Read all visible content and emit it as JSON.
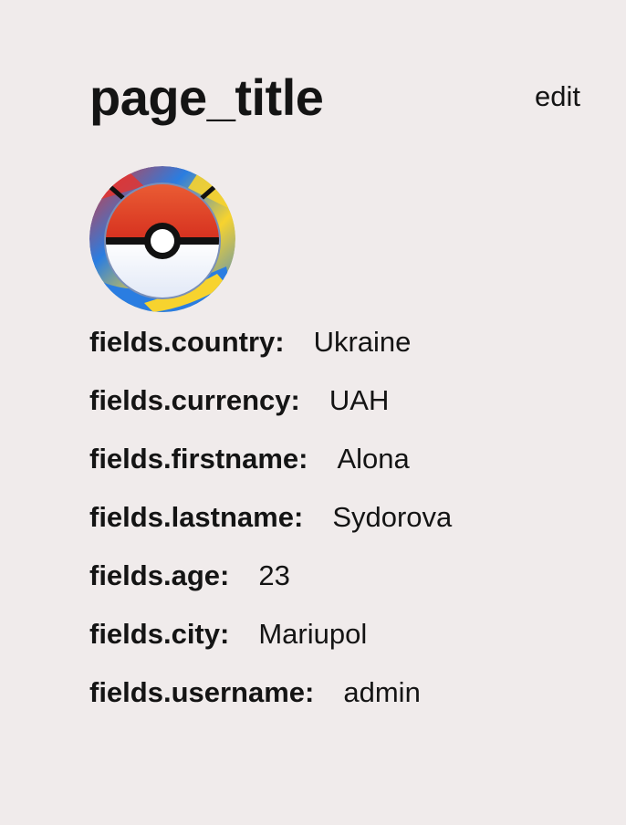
{
  "header": {
    "title": "page_title",
    "edit_label": "edit"
  },
  "avatar": {
    "icon": "pokeball-icon",
    "colors": {
      "ring_blue": "#2a7de1",
      "ring_yellow": "#f7d32e",
      "ring_red": "#e8322a",
      "ball_top": "#e3402a",
      "ball_bottom": "#e6edf8",
      "band": "#111111"
    }
  },
  "fields": [
    {
      "label": "fields.country:",
      "value": "Ukraine"
    },
    {
      "label": "fields.currency:",
      "value": "UAH"
    },
    {
      "label": "fields.firstname:",
      "value": "Alona"
    },
    {
      "label": "fields.lastname:",
      "value": "Sydorova"
    },
    {
      "label": "fields.age:",
      "value": "23"
    },
    {
      "label": "fields.city:",
      "value": "Mariupol"
    },
    {
      "label": "fields.username:",
      "value": "admin"
    }
  ]
}
